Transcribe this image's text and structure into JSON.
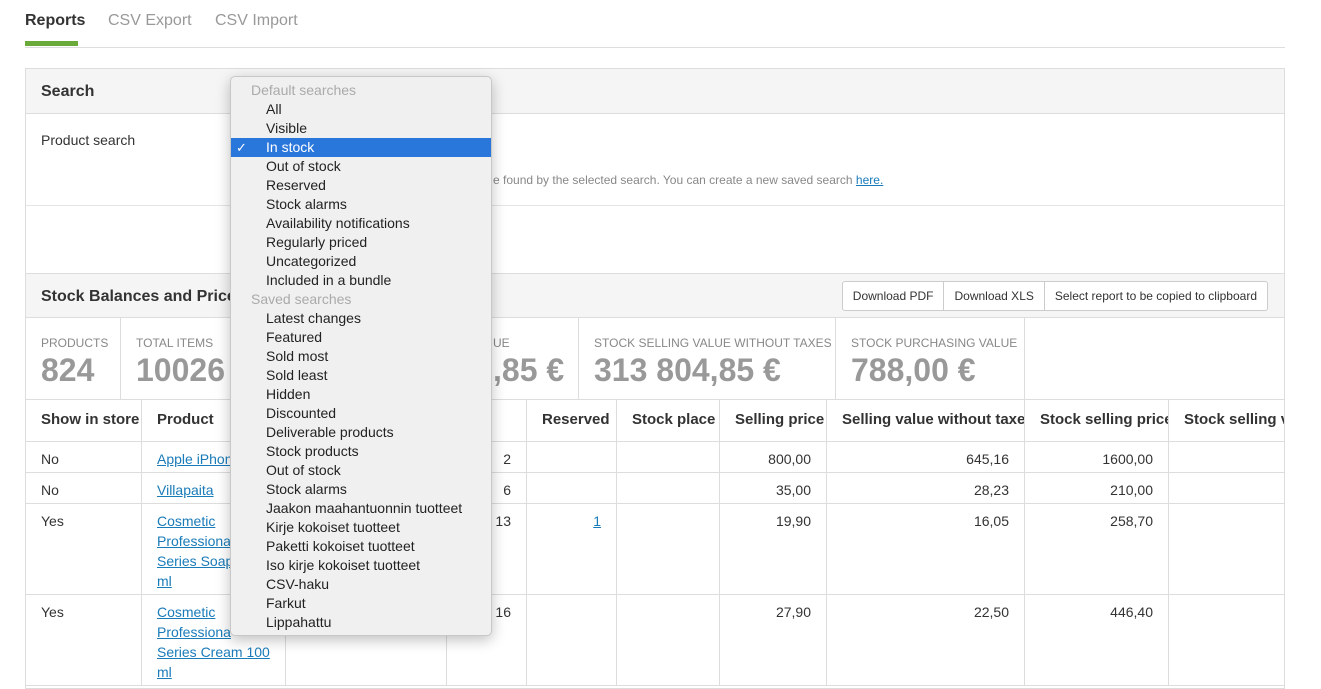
{
  "tabs": [
    {
      "label": "Reports",
      "active": true
    },
    {
      "label": "CSV Export",
      "active": false
    },
    {
      "label": "CSV Import",
      "active": false
    }
  ],
  "search": {
    "title": "Search",
    "product_search_label": "Product search",
    "help_text": "e found by the selected search. You can create a new saved search",
    "help_link": "here."
  },
  "report": {
    "title": "Stock Balances and Prices 2",
    "buttons": {
      "pdf": "Download PDF",
      "xls": "Download XLS",
      "clipboard": "Select report to be copied to clipboard"
    }
  },
  "stats": [
    {
      "label": "PRODUCTS",
      "value": "824"
    },
    {
      "label": "TOTAL ITEMS",
      "value": "10026"
    },
    {
      "label": "UE",
      "value": ",85 €"
    },
    {
      "label": "STOCK SELLING VALUE WITHOUT TAXES",
      "value": "313 804,85 €"
    },
    {
      "label": "STOCK PURCHASING VALUE",
      "value": "788,00 €"
    }
  ],
  "table": {
    "headers": [
      "Show in store",
      "Product",
      "",
      "ock",
      "Reserved",
      "Stock place",
      "Selling price",
      "Selling value without taxes",
      "Stock selling price",
      "Stock selling val"
    ],
    "rows": [
      {
        "show": "No",
        "product": "Apple iPhon",
        "stock": "2",
        "reserved": "",
        "place": "",
        "price": "800,00",
        "value_wo_tax": "645,16",
        "stock_price": "1600,00"
      },
      {
        "show": "No",
        "product": "Villapaita",
        "stock": "6",
        "reserved": "",
        "place": "",
        "price": "35,00",
        "value_wo_tax": "28,23",
        "stock_price": "210,00"
      },
      {
        "show": "Yes",
        "product_lines": [
          "Cosmetic",
          "Professiona",
          "Series Soap",
          "ml"
        ],
        "stock": "13",
        "reserved": "1",
        "place": "",
        "price": "19,90",
        "value_wo_tax": "16,05",
        "stock_price": "258,70"
      },
      {
        "show": "Yes",
        "product_lines": [
          "Cosmetic",
          "Professiona",
          "Series Cream 100",
          "ml"
        ],
        "stock": "16",
        "reserved": "",
        "place": "",
        "price": "27,90",
        "value_wo_tax": "22,50",
        "stock_price": "446,40"
      }
    ]
  },
  "dropdown": {
    "default_group": "Default searches",
    "default_items": [
      "All",
      "Visible",
      "In stock",
      "Out of stock",
      "Reserved",
      "Stock alarms",
      "Availability notifications",
      "Regularly priced",
      "Uncategorized",
      "Included in a bundle"
    ],
    "selected": "In stock",
    "check_mark": "✓",
    "saved_group": "Saved searches",
    "saved_items": [
      "Latest changes",
      "Featured",
      "Sold most",
      "Sold least",
      "Hidden",
      "Discounted",
      "Deliverable products",
      "Stock products",
      "Out of stock",
      "Stock alarms",
      "Jaakon maahantuonnin tuotteet",
      "Kirje kokoiset tuotteet",
      "Paketti kokoiset tuotteet",
      "Iso kirje kokoiset tuotteet",
      "CSV-haku",
      "Farkut",
      "Lippahattu"
    ]
  },
  "colors": {
    "accent": "#6aaa3a",
    "link": "#1a7bb9",
    "selected": "#2a77dc"
  }
}
